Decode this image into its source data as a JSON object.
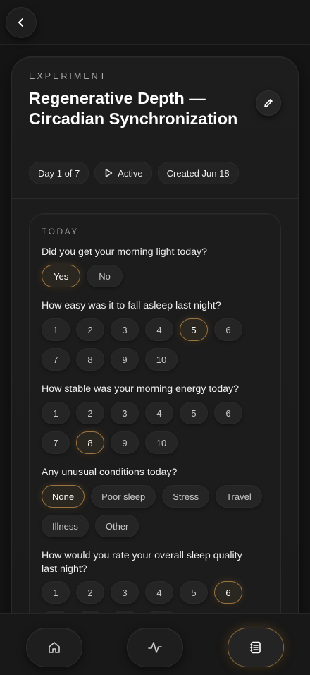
{
  "header": {
    "back_icon": "chevron-left-icon"
  },
  "experiment": {
    "eyebrow": "EXPERIMENT",
    "title": "Regenerative Depth — Circadian Synchronization",
    "edit_icon": "pencil-icon",
    "meta": {
      "day": "Day 1 of 7",
      "status": "Active",
      "created": "Created Jun 18"
    }
  },
  "today": {
    "label": "TODAY",
    "questions": [
      {
        "text": "Did you get your morning light today?",
        "options": [
          "Yes",
          "No"
        ],
        "selected": "Yes"
      },
      {
        "text": "How easy was it to fall asleep last night?",
        "options": [
          "1",
          "2",
          "3",
          "4",
          "5",
          "6",
          "7",
          "8",
          "9",
          "10"
        ],
        "selected": "5"
      },
      {
        "text": "How stable was your morning energy today?",
        "options": [
          "1",
          "2",
          "3",
          "4",
          "5",
          "6",
          "7",
          "8",
          "9",
          "10"
        ],
        "selected": "8"
      },
      {
        "text": "Any unusual conditions today?",
        "options": [
          "None",
          "Poor sleep",
          "Stress",
          "Travel",
          "Illness",
          "Other"
        ],
        "selected": "None"
      },
      {
        "text": "How would you rate your overall sleep quality last night?",
        "options": [
          "1",
          "2",
          "3",
          "4",
          "5",
          "6"
        ],
        "selected": "6"
      }
    ]
  },
  "colors": {
    "accent": "#9b7440",
    "background": "#151515",
    "card": "#1d1d1d"
  },
  "nav": {
    "items": [
      {
        "icon": "home-icon",
        "active": false
      },
      {
        "icon": "activity-icon",
        "active": false
      },
      {
        "icon": "journal-icon",
        "active": true
      }
    ]
  }
}
